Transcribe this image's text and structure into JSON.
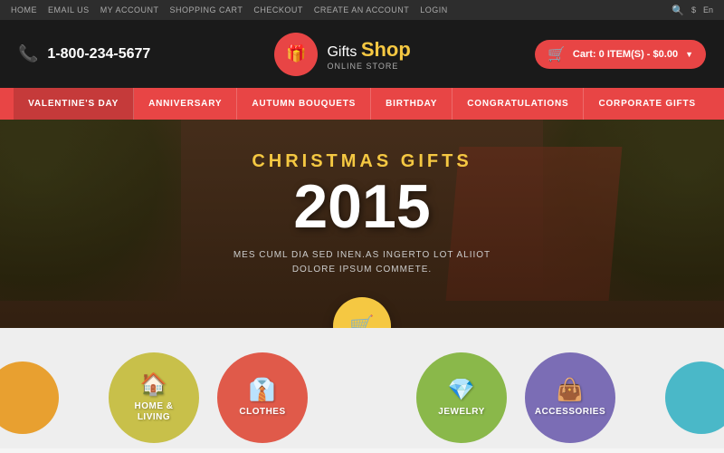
{
  "topbar": {
    "links": [
      "HOME",
      "EMAIL US",
      "MY ACCOUNT",
      "SHOPPING CART",
      "CHECKOUT",
      "CREATE AN ACCOUNT",
      "LOGIN"
    ],
    "currency": "$",
    "language": "En"
  },
  "header": {
    "phone": "1-800-234-5677",
    "logo_gifts": "Gifts",
    "logo_shop": "Shop",
    "logo_subtitle": "ONLINE STORE",
    "cart_label": "Cart:",
    "cart_items": "0 ITEM(S) - $0.00"
  },
  "nav": {
    "items": [
      "VALENTINE'S DAY",
      "ANNIVERSARY",
      "AUTUMN BOUQUETS",
      "BIRTHDAY",
      "CONGRATULATIONS",
      "CORPORATE GIFTS"
    ]
  },
  "hero": {
    "subtitle": "CHRISTMAS GIFTS",
    "year": "2015",
    "description_line1": "MES CUML DIA SED INEN.AS INGERTO LOT ALIIOT",
    "description_line2": "DOLORE IPSUM COMMETE."
  },
  "categories": {
    "items": [
      {
        "id": "home-living",
        "label": "HOME &\nLIVING",
        "color": "#c8c04a",
        "icon": "🏠"
      },
      {
        "id": "clothes",
        "label": "CLOTHES",
        "color": "#e05a4a",
        "icon": "👔"
      },
      {
        "id": "jewelry",
        "label": "JEWELRY",
        "color": "#8ab84a",
        "icon": "💎"
      },
      {
        "id": "accessories",
        "label": "ACCESSORIES",
        "color": "#7b6db5",
        "icon": "👜"
      }
    ]
  }
}
